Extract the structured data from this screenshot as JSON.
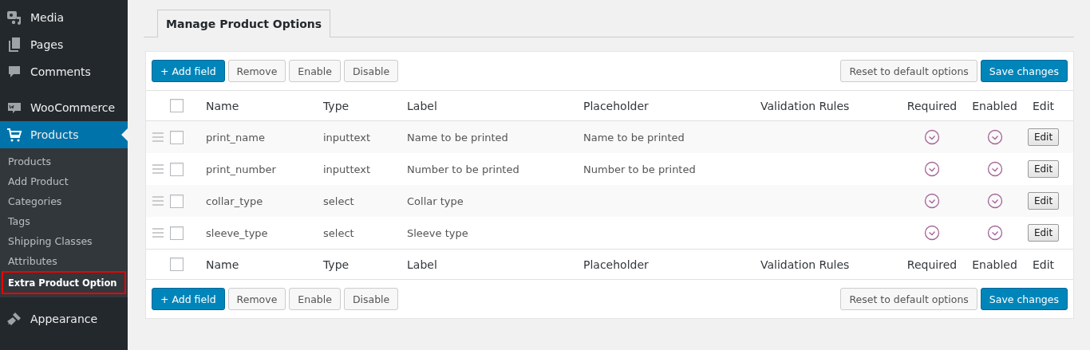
{
  "sidebar": {
    "items": [
      {
        "kind": "item",
        "label": "Media",
        "selected": false
      },
      {
        "kind": "item",
        "label": "Pages",
        "selected": false
      },
      {
        "kind": "item",
        "label": "Comments",
        "selected": false
      },
      {
        "kind": "separator"
      },
      {
        "kind": "item",
        "label": "WooCommerce",
        "selected": false
      },
      {
        "kind": "item",
        "label": "Products",
        "selected": true,
        "children": [
          {
            "label": "Products",
            "selected": false,
            "highlighted": false
          },
          {
            "label": "Add Product",
            "selected": false,
            "highlighted": false
          },
          {
            "label": "Categories",
            "selected": false,
            "highlighted": false
          },
          {
            "label": "Tags",
            "selected": false,
            "highlighted": false
          },
          {
            "label": "Shipping Classes",
            "selected": false,
            "highlighted": false
          },
          {
            "label": "Attributes",
            "selected": false,
            "highlighted": false
          },
          {
            "label": "Extra Product Option",
            "selected": true,
            "highlighted": true
          }
        ]
      },
      {
        "kind": "item",
        "label": "Appearance",
        "selected": false
      }
    ]
  },
  "tabs": [
    {
      "label": "Manage Product Options",
      "selected": true
    }
  ],
  "toolbar": {
    "left": [
      {
        "label": "+ Add field",
        "primary": true
      },
      {
        "label": "Remove",
        "primary": false
      },
      {
        "label": "Enable",
        "primary": false
      },
      {
        "label": "Disable",
        "primary": false
      }
    ],
    "right": [
      {
        "label": "Reset to default options",
        "primary": false
      },
      {
        "label": "Save changes",
        "primary": true
      }
    ]
  },
  "table": {
    "columns": [
      "Name",
      "Type",
      "Label",
      "Placeholder",
      "Validation Rules",
      "Required",
      "Enabled",
      "Edit"
    ],
    "header_checked": false,
    "rows": [
      {
        "checked": false,
        "name": "print_name",
        "type": "inputtext",
        "label": "Name to be printed",
        "placeholder": "Name to be printed",
        "required": true,
        "enabled": true,
        "edit": "Edit"
      },
      {
        "checked": false,
        "name": "print_number",
        "type": "inputtext",
        "label": "Number to be printed",
        "placeholder": "Number to be printed",
        "required": true,
        "enabled": true,
        "edit": "Edit"
      },
      {
        "checked": false,
        "name": "collar_type",
        "type": "select",
        "label": "Collar type",
        "required": true,
        "enabled": true,
        "edit": "Edit"
      },
      {
        "checked": false,
        "name": "sleeve_type",
        "type": "select",
        "label": "Sleeve type",
        "required": true,
        "enabled": true,
        "edit": "Edit"
      }
    ],
    "footer_columns": [
      "Name",
      "Type",
      "Label",
      "Placeholder",
      "Validation Rules",
      "Required",
      "Enabled",
      "Edit"
    ],
    "footer_checked": false
  },
  "bottom_toolbar": {
    "left": [
      {
        "label": "+ Add field",
        "primary": true
      },
      {
        "label": "Remove",
        "primary": false
      },
      {
        "label": "Enable",
        "primary": false
      },
      {
        "label": "Disable",
        "primary": false
      }
    ],
    "right": [
      {
        "label": "Reset to default options",
        "primary": false
      },
      {
        "label": "Save changes",
        "primary": true
      }
    ]
  }
}
